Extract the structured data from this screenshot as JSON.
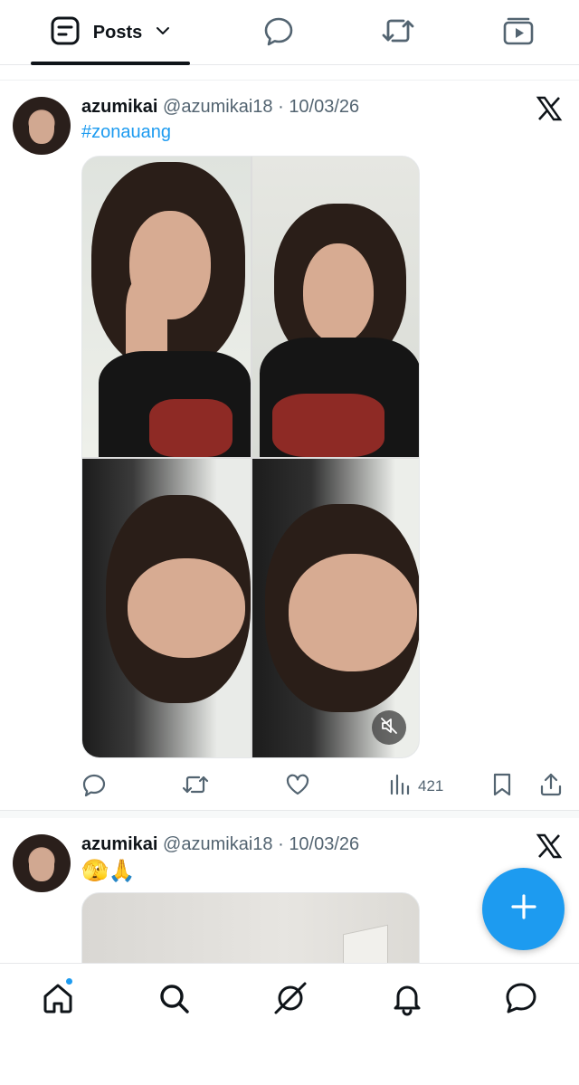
{
  "top_tabs": {
    "posts_label": "Posts",
    "icons": [
      "posts-icon",
      "chevron-down-icon",
      "reply-icon",
      "repost-icon",
      "media-icon"
    ]
  },
  "posts": [
    {
      "name": "azumikai",
      "handle": "@azumikai18",
      "separator": "·",
      "date": "10/03/26",
      "text": "#zonauang",
      "media": "four-photo grid",
      "views": "421"
    },
    {
      "name": "azumikai",
      "handle": "@azumikai18",
      "separator": "·",
      "date": "10/03/26",
      "text": "🫣🙏"
    }
  ],
  "fab": {
    "icon": "plus-icon"
  },
  "bottom_nav": [
    "home-icon",
    "search-icon",
    "grok-icon",
    "bell-icon",
    "messages-icon"
  ],
  "colors": {
    "accent": "#1d9bf0",
    "text": "#0f1419",
    "muted": "#536471"
  }
}
